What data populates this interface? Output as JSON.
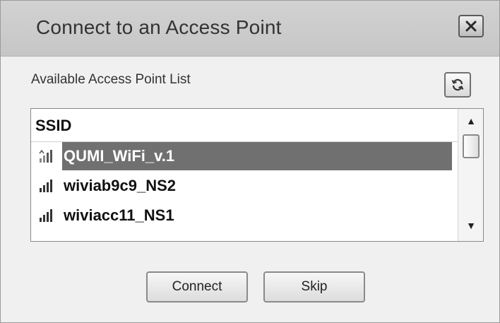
{
  "window": {
    "title": "Connect to an Access Point",
    "close_icon": "close-icon"
  },
  "access_points": {
    "section_label": "Available Access Point List",
    "refresh_icon": "refresh-icon",
    "column_header": "SSID",
    "items": [
      {
        "ssid": "QUMI_WiFi_v.1",
        "selected": true,
        "signal_icon": "wifi-signal-icon"
      },
      {
        "ssid": "wiviab9c9_NS2",
        "selected": false,
        "signal_icon": "wifi-signal-icon"
      },
      {
        "ssid": "wiviacc11_NS1",
        "selected": false,
        "signal_icon": "wifi-signal-icon"
      }
    ],
    "scroll_up_icon": "scroll-up-arrow-icon",
    "scroll_down_icon": "scroll-down-arrow-icon"
  },
  "buttons": {
    "connect_label": "Connect",
    "skip_label": "Skip"
  },
  "colors": {
    "titlebar": "#c8c8c8",
    "selection_highlight": "#707070",
    "dialog_background": "#f0f0f0"
  }
}
